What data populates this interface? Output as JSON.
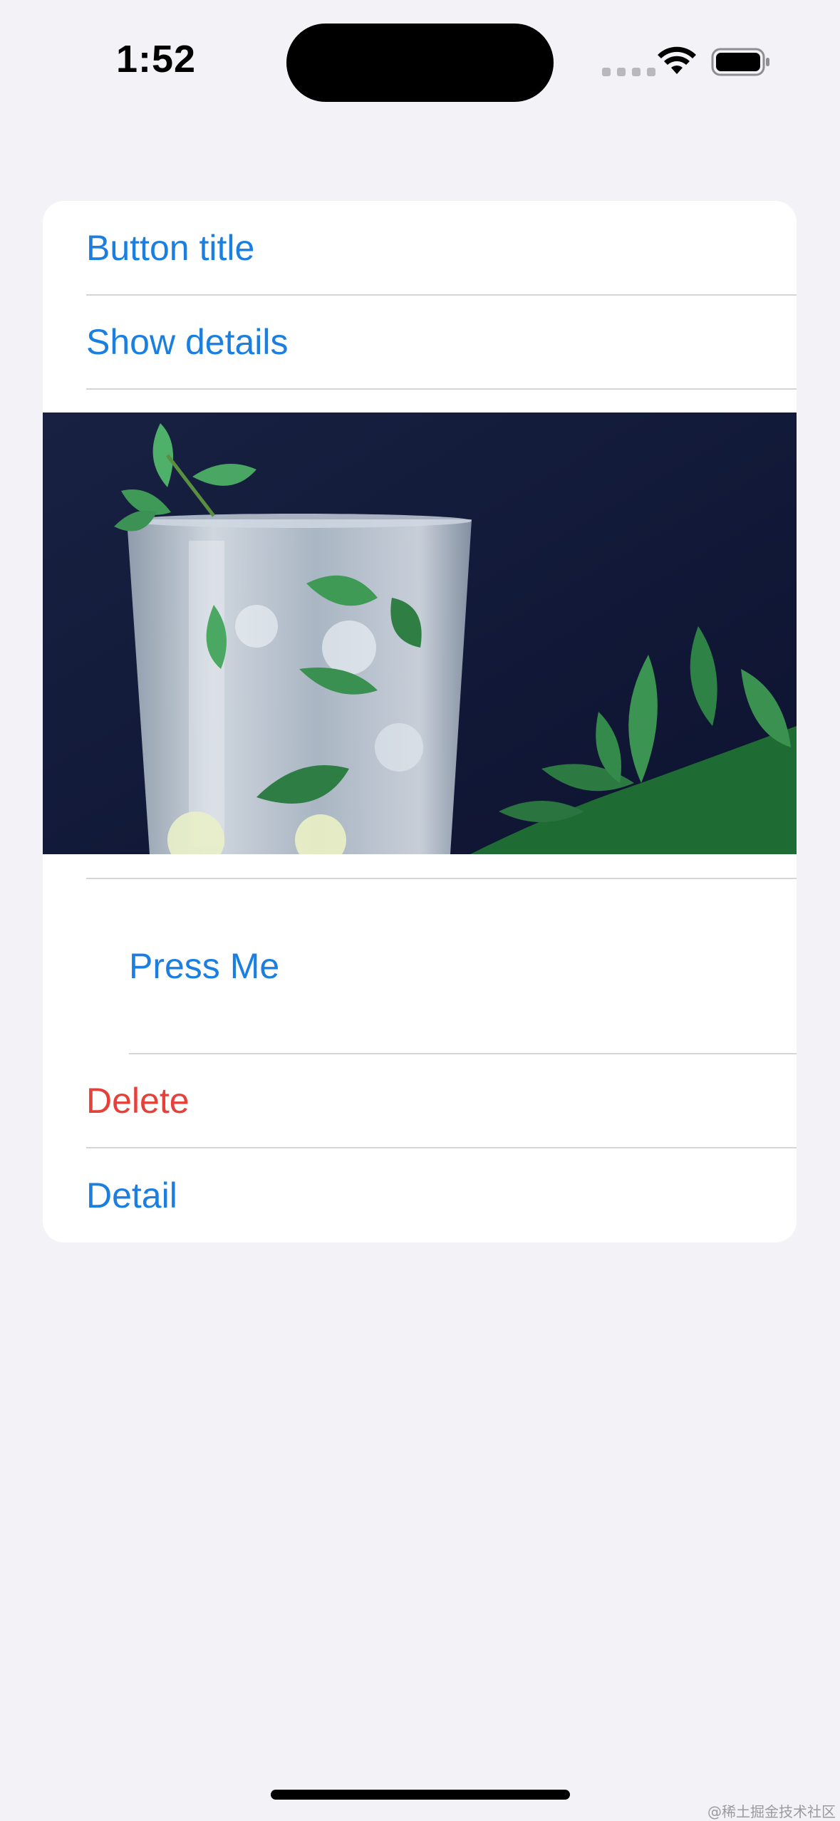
{
  "status_bar": {
    "time": "1:52"
  },
  "list": {
    "items": [
      {
        "label": "Button title"
      },
      {
        "label": "Show details"
      },
      {
        "label": "Press Me"
      },
      {
        "label": "Delete"
      },
      {
        "label": "Detail"
      }
    ],
    "image": {
      "subject": "mojito glass with mint leaves",
      "colors": {
        "background": "#121a36",
        "mint": "#3f9a55",
        "glass": "#c8d2dc"
      }
    }
  },
  "watermark": "@稀土掘金技术社区",
  "colors": {
    "accent": "#1a7fe0",
    "destructive": "#e5413a",
    "background": "#f2f2f7",
    "card": "#ffffff"
  },
  "icons": [
    "signal-icon",
    "wifi-icon",
    "battery-icon"
  ]
}
